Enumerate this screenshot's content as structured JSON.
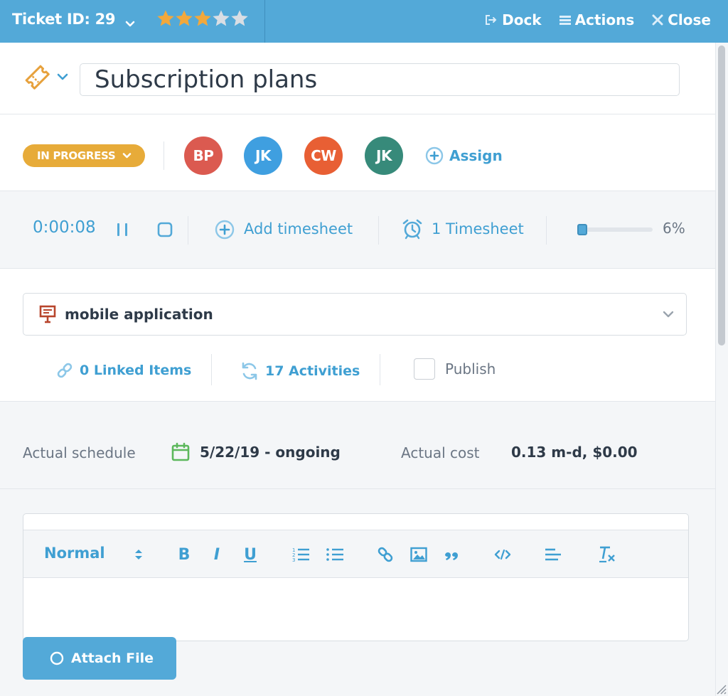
{
  "header": {
    "ticket_label": "Ticket ID: 29",
    "rating": 3,
    "rating_max": 5,
    "actions": {
      "dock": "Dock",
      "actions": "Actions",
      "close": "Close"
    }
  },
  "ticket": {
    "title": "Subscription plans",
    "status": "IN PROGRESS",
    "assignees": [
      {
        "initials": "BP",
        "color": "#db5a50"
      },
      {
        "initials": "JK",
        "color": "#3f9fe0"
      },
      {
        "initials": "CW",
        "color": "#e85f34"
      },
      {
        "initials": "JK",
        "color": "#378a7a"
      }
    ],
    "assign_label": "Assign"
  },
  "timer": {
    "elapsed": "0:00:08",
    "add_timesheet": "Add timesheet",
    "timesheet_count": "1 Timesheet",
    "progress_percent": 6,
    "progress_label": "6%"
  },
  "project": {
    "name": "mobile application",
    "linked_items": "0 Linked Items",
    "activities": "17 Activities",
    "publish_label": "Publish",
    "publish_checked": false
  },
  "schedule": {
    "actual_schedule_label": "Actual schedule",
    "actual_schedule_value": "5/22/19 - ongoing",
    "actual_cost_label": "Actual cost",
    "actual_cost_value": "0.13 m-d, $0.00"
  },
  "editor": {
    "format_label": "Normal",
    "tools": [
      "bold-icon",
      "italic-icon",
      "underline-icon",
      "ordered-list-icon",
      "bullet-list-icon",
      "link-icon",
      "image-icon",
      "quote-icon",
      "code-icon",
      "align-icon",
      "clear-format-icon"
    ]
  },
  "attach_button": "Attach File",
  "colors": {
    "brand": "#53a9d8",
    "link": "#3f9fd2",
    "status": "#e7ab39",
    "star_filled": "#f2a83b",
    "star_empty": "#d9dee4"
  }
}
